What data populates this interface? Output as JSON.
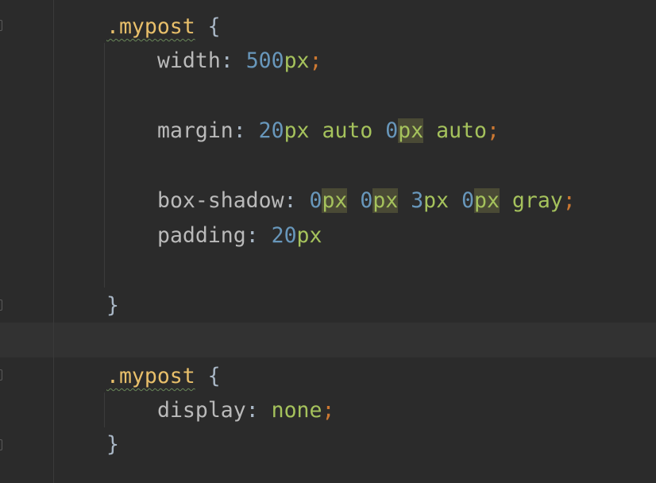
{
  "code": {
    "block1": {
      "selector": ".mypost",
      "open_brace": "{",
      "width": {
        "prop": "width",
        "colon": ":",
        "num": "500",
        "unit": "px",
        "semi": ";"
      },
      "margin": {
        "prop": "margin",
        "colon": ":",
        "v1_num": "20",
        "v1_unit": "px",
        "v2": "auto",
        "v3_num": "0",
        "v3_unit": "px",
        "v4": "auto",
        "semi": ";"
      },
      "box_shadow": {
        "prop": "box-shadow",
        "colon": ":",
        "v1_num": "0",
        "v1_unit": "px",
        "v2_num": "0",
        "v2_unit": "px",
        "v3_num": "3",
        "v3_unit": "px",
        "v4_num": "0",
        "v4_unit": "px",
        "color": "gray",
        "semi": ";"
      },
      "padding": {
        "prop": "padding",
        "colon": ":",
        "num": "20",
        "unit": "px"
      },
      "close_brace": "}"
    },
    "block2": {
      "selector": ".mypost",
      "open_brace": "{",
      "display": {
        "prop": "display",
        "colon": ":",
        "value": "none",
        "semi": ";"
      },
      "close_brace": "}"
    }
  },
  "colors": {
    "background": "#2b2b2b",
    "current_line": "#323232",
    "selector": "#e8bf6a",
    "number": "#6897bb",
    "unit_and_keyword": "#a5c25c",
    "semicolon": "#cc7832",
    "property": "#bababa",
    "highlight": "#4a4a35"
  }
}
